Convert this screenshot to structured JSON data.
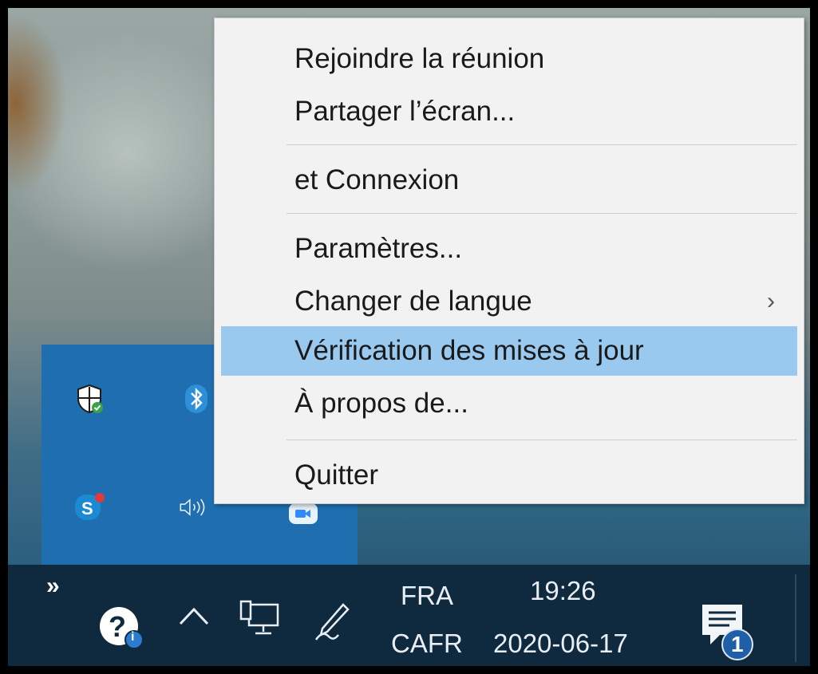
{
  "context_menu": {
    "items": [
      {
        "label": "Rejoindre la réunion"
      },
      {
        "label": "Partager l’écran..."
      },
      {
        "label": "et Connexion"
      },
      {
        "label": "Paramètres..."
      },
      {
        "label": "Changer de langue",
        "submenu_glyph": "›"
      },
      {
        "label": "Vérification des mises à jour",
        "highlighted": true
      },
      {
        "label": "À propos de..."
      },
      {
        "label": "Quitter"
      }
    ]
  },
  "tray_overflow": {
    "icons": [
      "windows-security-icon",
      "bluetooth-icon",
      "skype-icon",
      "volume-icon",
      "zoom-icon"
    ]
  },
  "taskbar": {
    "overflow_glyph": "»",
    "show_hidden_glyph": "^",
    "language_primary": "FRA",
    "language_secondary": "CAFR",
    "time": "19:26",
    "date": "2020-06-17",
    "notification_count": "1",
    "help_badge": "i"
  },
  "colors": {
    "menu_bg": "#f2f2f2",
    "menu_highlight": "#99c9ef",
    "taskbar_bg": "#0f2a3e",
    "overflow_bg": "#1f6fb0"
  }
}
